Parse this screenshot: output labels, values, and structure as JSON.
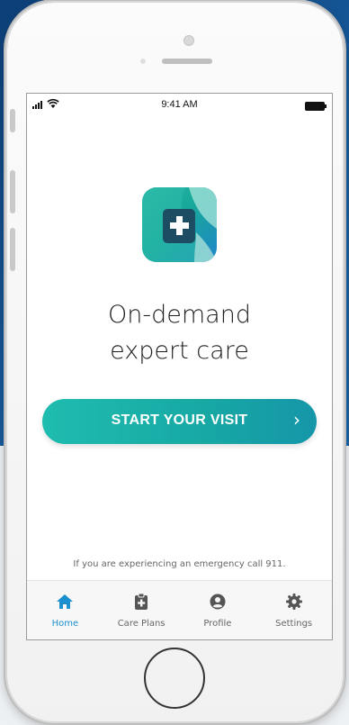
{
  "status_bar": {
    "time": "9:41 AM"
  },
  "app": {
    "logo_icon": "medical-cross-app-logo",
    "headline_line1": "On-demand",
    "headline_line2": "expert care",
    "cta_label": "START YOUR VISIT",
    "cta_chevron": "›",
    "emergency_note": "If you are experiencing an emergency call 911."
  },
  "tabbar": {
    "items": [
      {
        "label": "Home",
        "icon": "home-icon",
        "active": true
      },
      {
        "label": "Care Plans",
        "icon": "medical-clipboard-icon",
        "active": false
      },
      {
        "label": "Profile",
        "icon": "user-icon",
        "active": false
      },
      {
        "label": "Settings",
        "icon": "gear-icon",
        "active": false
      }
    ]
  },
  "colors": {
    "accent": "#1bb3ab",
    "active_tab": "#1b8fd0",
    "inactive_tab": "#555555",
    "background_top": "#0f4c8c"
  }
}
